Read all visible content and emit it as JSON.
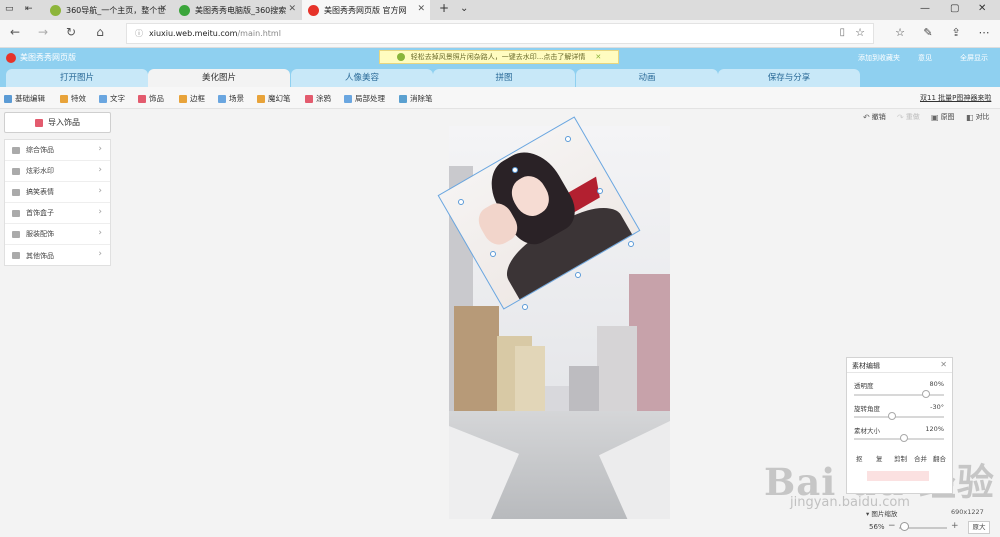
{
  "browser": {
    "tabs": [
      {
        "title": "360导航_一个主页，整个世",
        "fav_color": "#8db53a"
      },
      {
        "title": "美图秀秀电脑版_360搜索",
        "fav_color": "#3ba53b"
      },
      {
        "title": "美图秀秀网页版 官方网",
        "fav_color": "#e6332a"
      }
    ],
    "url_host": "xiuxiu.web.meitu.com",
    "url_path": "/main.html"
  },
  "header": {
    "logo_text": "美图秀秀网页版",
    "banner_text": "轻松去掉风景照片闲杂路人，一键去水印...点击了解详情",
    "links": [
      "添加到收藏夹",
      "意见",
      "全屏显示"
    ]
  },
  "main_tabs": [
    "打开图片",
    "美化图片",
    "人像美容",
    "拼图",
    "动画",
    "保存与分享"
  ],
  "selected_tab": "美化图片",
  "toolbar": {
    "items": [
      {
        "label": "基础编辑",
        "color": "#5b9bd5"
      },
      {
        "label": "特效",
        "color": "#e8a33a"
      },
      {
        "label": "文字",
        "color": "#6aa6e0"
      },
      {
        "label": "饰品",
        "color": "#e35b6e"
      },
      {
        "label": "边框",
        "color": "#e8a33a"
      },
      {
        "label": "场景",
        "color": "#6aa6e0"
      },
      {
        "label": "魔幻笔",
        "color": "#e8a33a"
      },
      {
        "label": "涂鸦",
        "color": "#e35b6e"
      },
      {
        "label": "局部处理",
        "color": "#6aa6e0"
      },
      {
        "label": "消除笔",
        "color": "#5aa0d0"
      }
    ],
    "batch_link": "双11 批量P图神器来啦"
  },
  "left_panel": {
    "import_label": "导入饰品",
    "categories": [
      "综合饰品",
      "炫彩水印",
      "搞笑表情",
      "首饰盒子",
      "服装配饰",
      "其他饰品"
    ]
  },
  "edit_buttons": [
    {
      "label": "撤销",
      "icon": "undo-icon",
      "enabled": true
    },
    {
      "label": "重做",
      "icon": "redo-icon",
      "enabled": false
    },
    {
      "label": "原图",
      "icon": "original-icon",
      "enabled": true
    },
    {
      "label": "对比",
      "icon": "compare-icon",
      "enabled": true
    }
  ],
  "material_editor": {
    "title": "素材编辑",
    "opacity_label": "透明度",
    "opacity_value": "80%",
    "opacity_fraction": 0.8,
    "rotation_label": "旋转角度",
    "rotation_value": "-30°",
    "rotation_fraction": 0.42,
    "size_label": "素材大小",
    "size_value": "120%",
    "size_fraction": 0.55,
    "buttons": [
      "抠",
      "复",
      "剪制",
      "合并",
      "翻合"
    ]
  },
  "zoom": {
    "header": "图片缩放",
    "dimensions": "690x1227",
    "percent": "56%",
    "original_label": "原大"
  },
  "watermark": {
    "main": "Bai du 经验",
    "sub": "jingyan.baidu.com"
  }
}
